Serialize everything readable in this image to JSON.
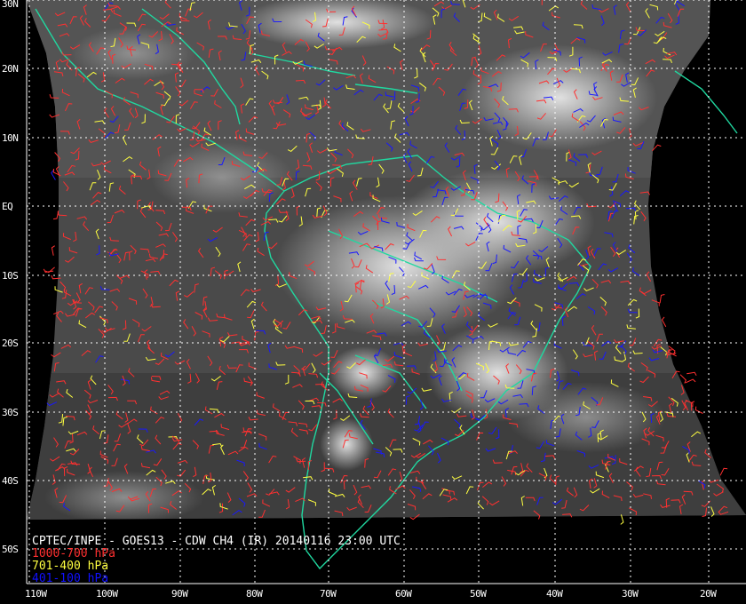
{
  "title": "CPTEC/INPE - GOES13 - CDW CH4 (IR) 20140116 23:00 UTC",
  "legend": [
    {
      "label": "1000-700 hPa",
      "color": "#ff3030"
    },
    {
      "label": "701-400 hPa",
      "color": "#ffff40"
    },
    {
      "label": "401-100 hPa",
      "color": "#1818ff"
    }
  ],
  "lat_labels": [
    "30N",
    "20N",
    "10N",
    "EQ",
    "10S",
    "20S",
    "30S",
    "40S",
    "50S"
  ],
  "lon_labels": [
    "110W",
    "100W",
    "90W",
    "80W",
    "70W",
    "60W",
    "50W",
    "40W",
    "30W",
    "20W"
  ],
  "colors": {
    "coast": "#20d8a0",
    "grid": "#ffffff",
    "background": "#000000",
    "cloud_field": "#4a4a4a"
  }
}
